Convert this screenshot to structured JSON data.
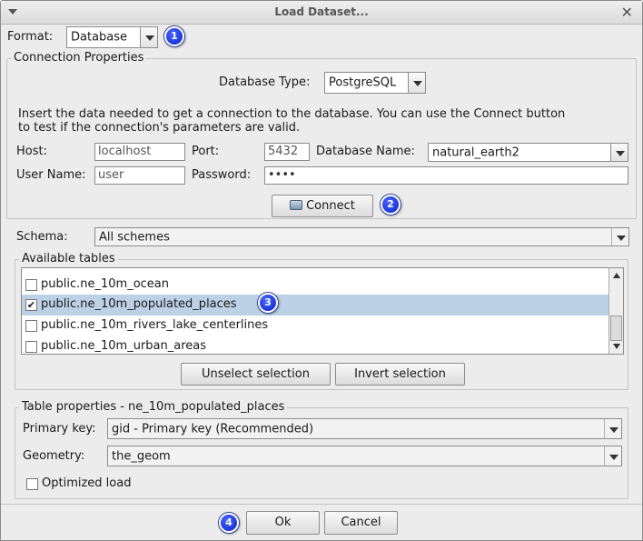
{
  "window": {
    "title": "Load Dataset..."
  },
  "format": {
    "label": "Format:",
    "value": "Database"
  },
  "connection": {
    "legend": "Connection Properties",
    "db_type_label": "Database Type:",
    "db_type_value": "PostgreSQL",
    "info_line1": "Insert the data needed to get a connection to the database. You can use the Connect button",
    "info_line2": "to test if the connection's parameters are valid.",
    "host_label": "Host:",
    "host_value": "localhost",
    "port_label": "Port:",
    "port_value": "5432",
    "dbname_label": "Database Name:",
    "dbname_value": "natural_earth2",
    "user_label": "User Name:",
    "user_value": "user",
    "password_label": "Password:",
    "password_value": "••••",
    "connect_label": "Connect"
  },
  "schema": {
    "label": "Schema:",
    "value": "All schemes"
  },
  "tables": {
    "legend": "Available tables",
    "items": [
      {
        "name": "public.ne_10m_ocean",
        "checked": false
      },
      {
        "name": "public.ne_10m_populated_places",
        "checked": true
      },
      {
        "name": "public.ne_10m_rivers_lake_centerlines",
        "checked": false
      },
      {
        "name": "public.ne_10m_urban_areas",
        "checked": false
      }
    ],
    "check_mark": "✔",
    "unselect_label": "Unselect selection",
    "invert_label": "Invert selection"
  },
  "table_props": {
    "legend": "Table properties - ne_10m_populated_places",
    "pk_label": "Primary key:",
    "pk_value": "gid - Primary key (Recommended)",
    "geom_label": "Geometry:",
    "geom_value": "the_geom",
    "optimized_label": "Optimized load"
  },
  "footer": {
    "ok_label": "Ok",
    "cancel_label": "Cancel"
  },
  "badges": [
    "1",
    "2",
    "3",
    "4"
  ]
}
